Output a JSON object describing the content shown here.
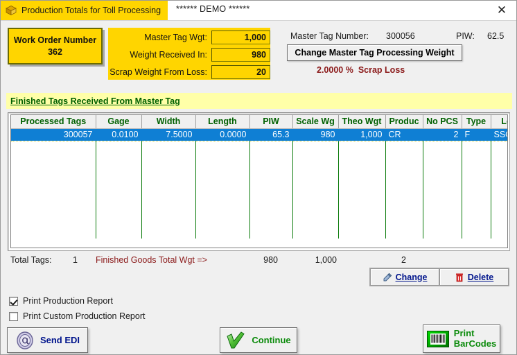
{
  "window": {
    "title": "Production Totals for Toll Processing",
    "demo_banner": "****** DEMO ******",
    "close_icon": "close-icon",
    "app_icon": "box-icon"
  },
  "work_order": {
    "label": "Work Order Number",
    "value": "362"
  },
  "weights": {
    "master_tag_wgt_label": "Master Tag Wgt:",
    "master_tag_wgt_value": "1,000",
    "weight_received_label": "Weight Received In:",
    "weight_received_value": "980",
    "scrap_weight_label": "Scrap Weight From Loss:",
    "scrap_weight_value": "20"
  },
  "master_tag": {
    "number_label": "Master Tag Number:",
    "number_value": "300056",
    "piw_label": "PIW:",
    "piw_value": "62.5",
    "change_button": "Change Master Tag Processing Weight",
    "scrap_loss_pct": "2.0000 %",
    "scrap_loss_label": "Scrap Loss"
  },
  "grid": {
    "banner": "Finished Tags Received From Master Tag",
    "columns": [
      "Processed Tags",
      "Gage",
      "Width",
      "Length",
      "PIW",
      "Scale Wg",
      "Theo Wgt",
      "Produc",
      "No PCS",
      "Type",
      "Location"
    ],
    "rows": [
      {
        "processed_tags": "300057",
        "gage": "0.0100",
        "width": "7.5000",
        "length": "0.0000",
        "piw": "65.3",
        "scale_wgt": "980",
        "theo_wgt": "1,000",
        "product": "CR",
        "no_pcs": "2",
        "type": "F",
        "location": "SSCSD"
      }
    ]
  },
  "totals": {
    "total_tags_label": "Total Tags:",
    "total_tags_value": "1",
    "finished_goods_label": "Finished Goods Total Wgt =>",
    "scale_total": "980",
    "theo_total": "1,000",
    "pcs_total": "2"
  },
  "row_actions": {
    "change_label": "Change",
    "change_icon": "pencil-icon",
    "delete_label": "Delete",
    "delete_icon": "trash-icon"
  },
  "options": {
    "print_production_report": "Print Production Report",
    "print_production_report_checked": true,
    "print_custom_production_report": "Print Custom Production Report",
    "print_custom_production_report_checked": false
  },
  "footer": {
    "send_edi_label": "Send EDI",
    "send_edi_icon": "at-sign-icon",
    "continue_label": "Continue",
    "continue_icon": "checkmark-icon",
    "print_barcodes_line1": "Print",
    "print_barcodes_line2": "BarCodes",
    "print_barcodes_icon": "barcode-icon"
  },
  "colors": {
    "title_chip": "#ffd500",
    "panel_yellow": "#ffd500",
    "banner_yellow": "#ffffa8",
    "header_green": "#006000",
    "selection_blue": "#0f7fd4",
    "accent_red": "#8b1a1a",
    "link_blue": "#00148c"
  }
}
